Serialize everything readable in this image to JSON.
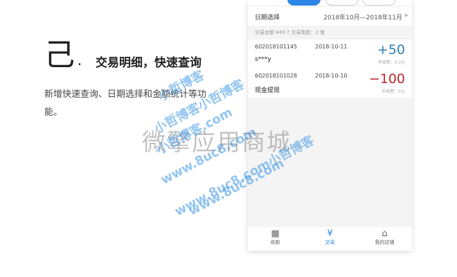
{
  "section": {
    "number": "己.",
    "title": "交易明细，快速查询",
    "description": "新增快速查询、日期选择和金额统计等功能。"
  },
  "phone": {
    "date_label": "日期选择",
    "date_range": "2018年10月—2018年11月",
    "summary": "交易金额 ¥49.7   交易笔数：2 笔",
    "transactions": [
      {
        "id": "602018101145",
        "date": "2018-10-11",
        "name": "s***y",
        "amount": "+50",
        "fee": "手续费：0.3元",
        "color": "#2e7fb8"
      },
      {
        "id": "602018101028",
        "date": "2018-10-10",
        "name": "现金提现",
        "amount": "−100",
        "fee": "手续费：0元",
        "color": "#c0282d"
      }
    ],
    "nav": [
      {
        "label": "收款",
        "icon": "qr-code-icon"
      },
      {
        "label": "交易",
        "icon": "yuan-icon"
      },
      {
        "label": "我的店铺",
        "icon": "store-icon"
      }
    ]
  },
  "watermarks": {
    "gray": "微擎应用商城",
    "blue": [
      "小哲博客",
      "小哲博客小哲博客",
      "小哲博客.com",
      "www.8uc8.com",
      "www.8uc8.com小哲博客",
      "www.8uc8.com"
    ]
  }
}
